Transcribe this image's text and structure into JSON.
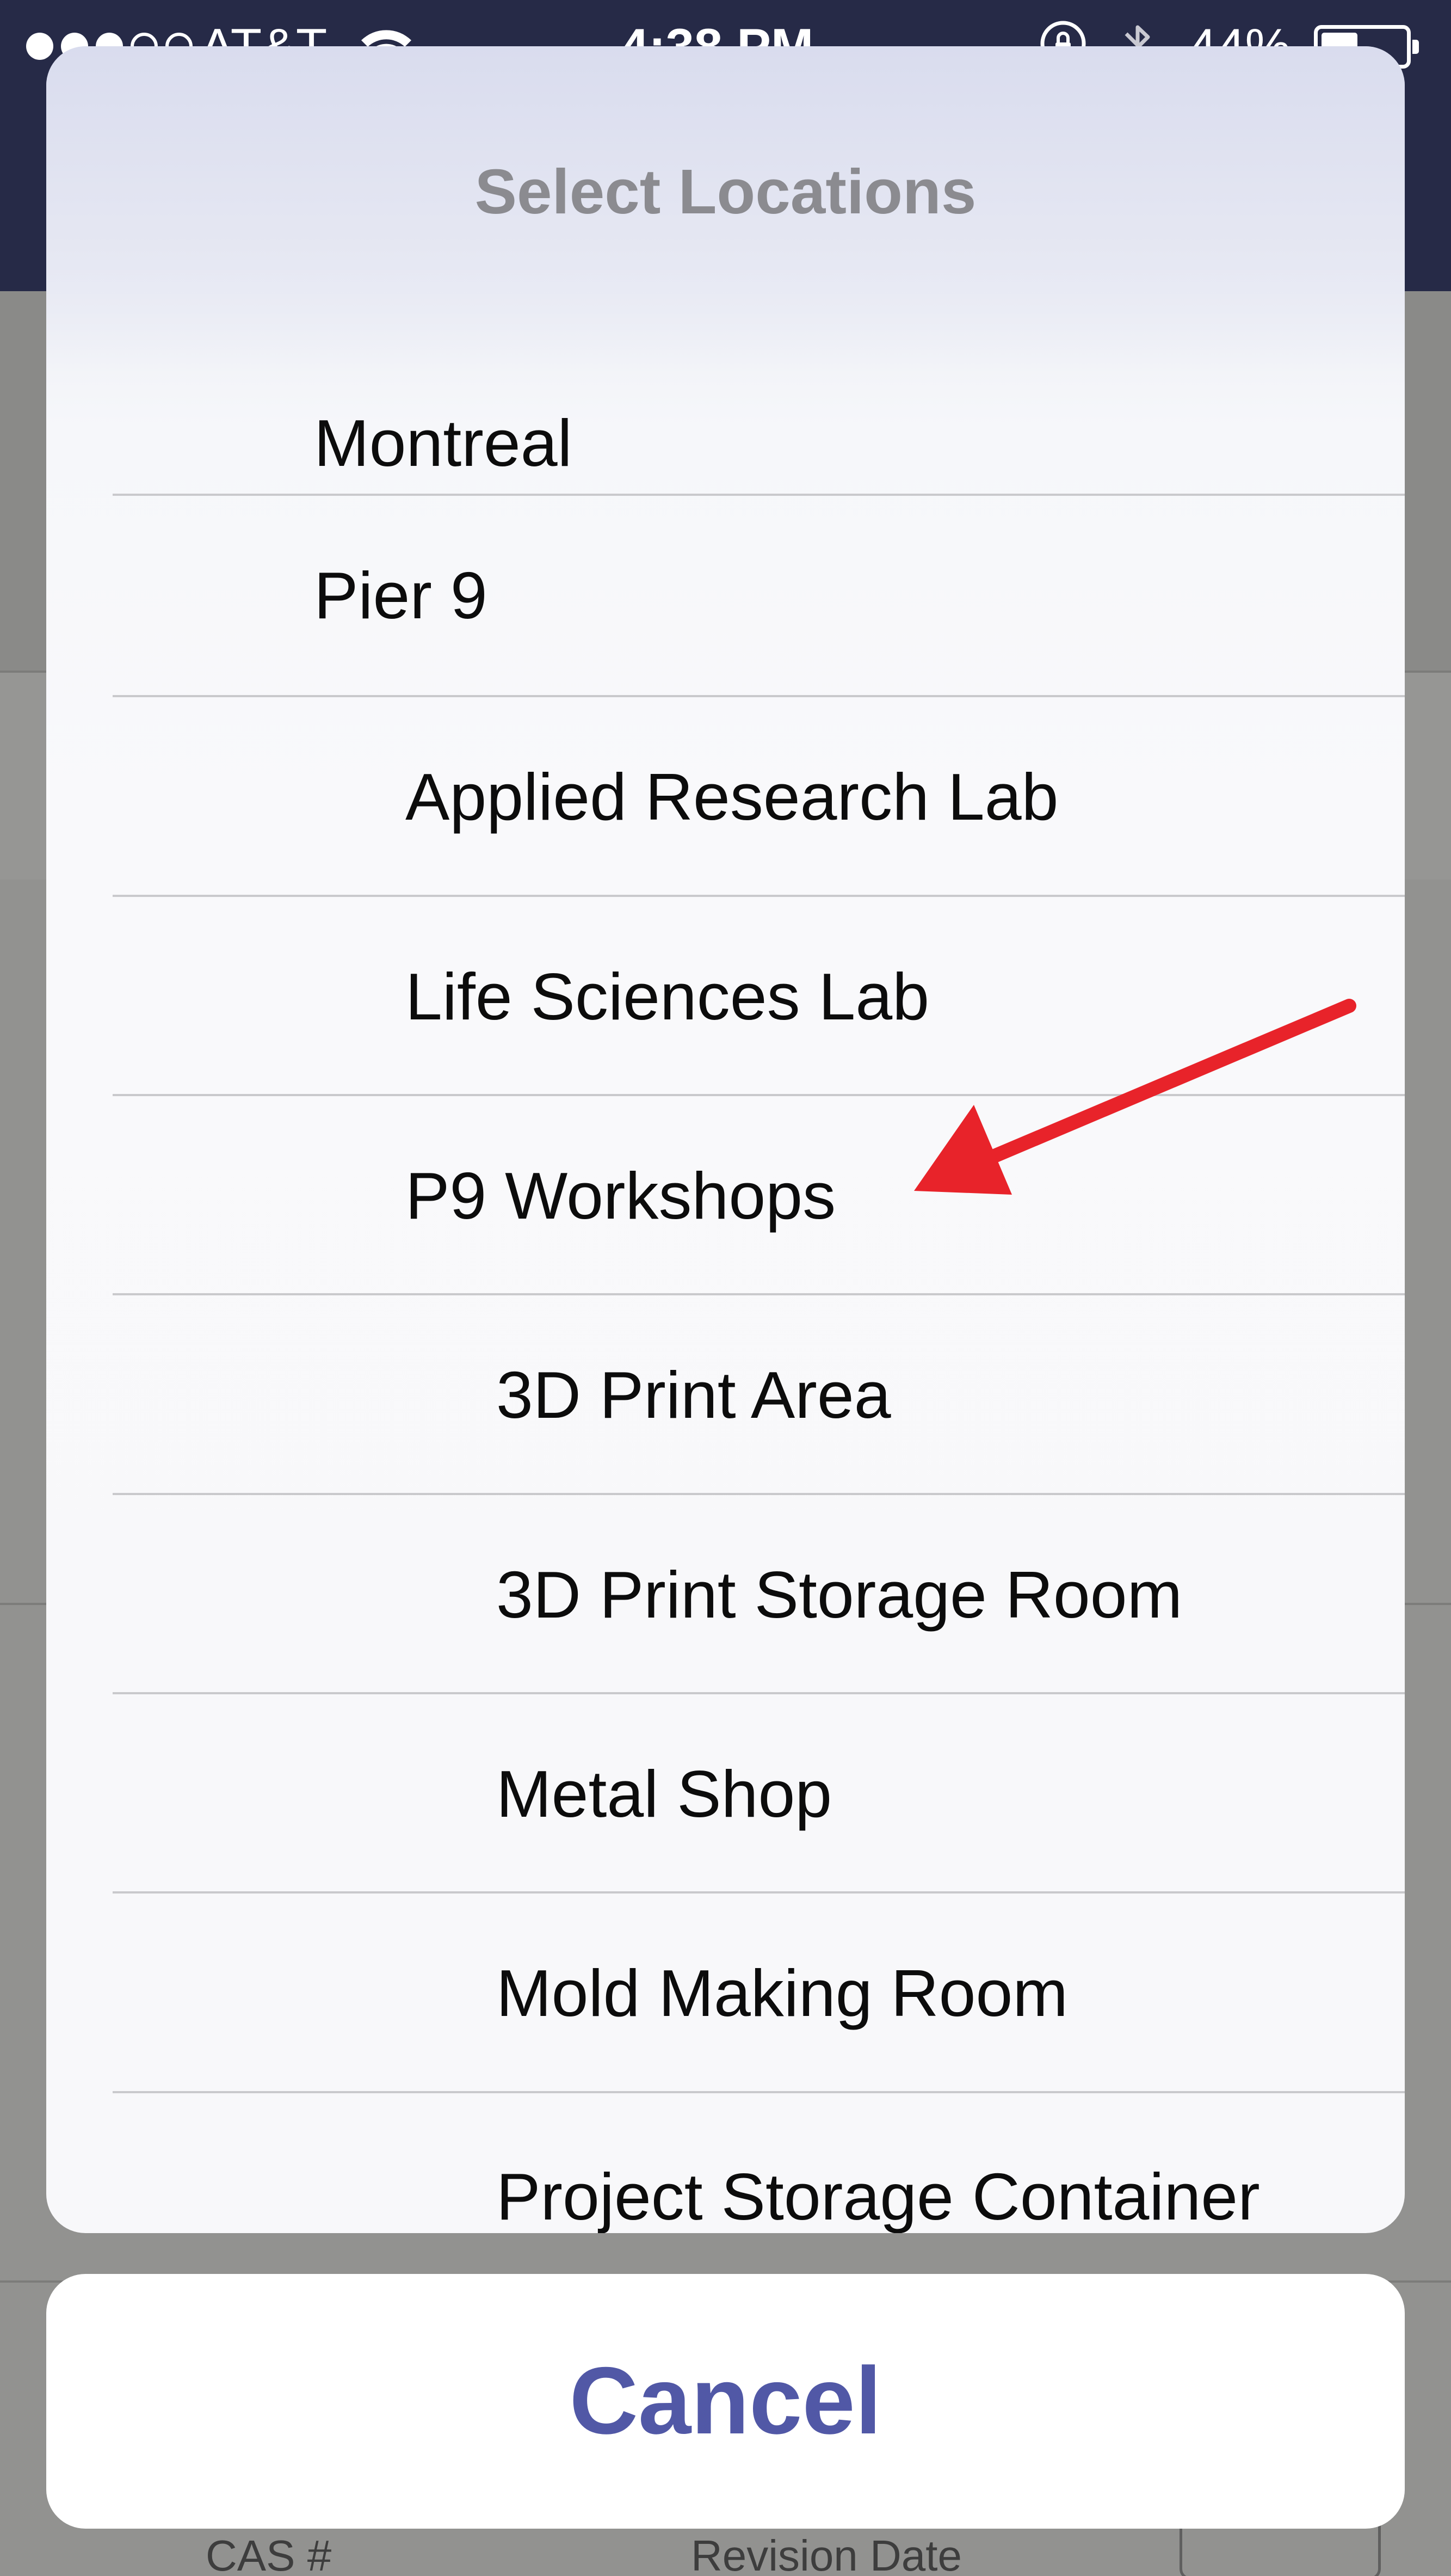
{
  "status_bar": {
    "carrier": "AT&T",
    "time": "4:38 PM",
    "battery_percent": "44%",
    "signal_bars_filled": 3,
    "signal_bars_total": 5,
    "battery_level": 0.44,
    "icons": [
      "wifi-icon",
      "orientation-lock-icon",
      "bluetooth-icon",
      "battery-icon"
    ]
  },
  "sheet": {
    "title": "Select Locations",
    "options": [
      {
        "label": "Montreal",
        "level": 1
      },
      {
        "label": "Pier 9",
        "level": 1
      },
      {
        "label": "Applied Research Lab",
        "level": 2
      },
      {
        "label": "Life Sciences Lab",
        "level": 2
      },
      {
        "label": "P9 Workshops",
        "level": 2
      },
      {
        "label": "3D Print Area",
        "level": 3
      },
      {
        "label": "3D Print Storage Room",
        "level": 3
      },
      {
        "label": "Metal Shop",
        "level": 3
      },
      {
        "label": "Mold Making Room",
        "level": 3
      },
      {
        "label": "Project Storage Container",
        "level": 3
      }
    ],
    "cancel_label": "Cancel"
  },
  "background": {
    "footer_left": "CAS #",
    "footer_right": "Revision Date"
  },
  "annotation": {
    "type": "arrow",
    "color": "#e8232a",
    "points_to": "P9 Workshops"
  },
  "colors": {
    "nav_bar": "#262a47",
    "cancel_text": "#5158a6",
    "title_text": "#8b8b90"
  }
}
